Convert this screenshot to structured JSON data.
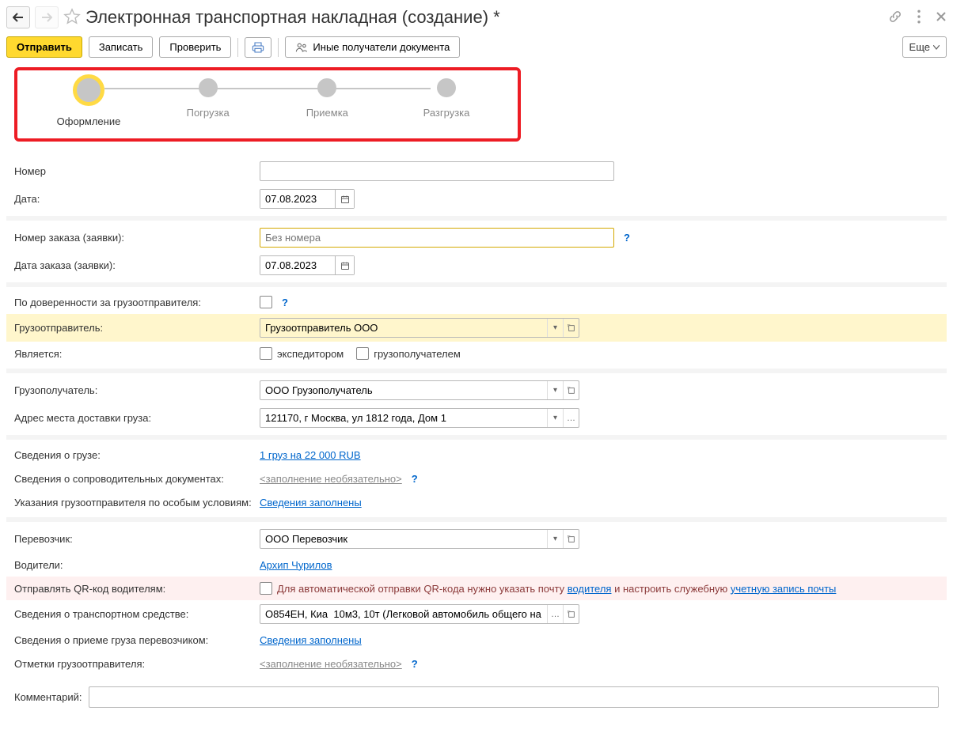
{
  "header": {
    "title": "Электронная транспортная накладная (создание) *"
  },
  "toolbar": {
    "send": "Отправить",
    "write": "Записать",
    "check": "Проверить",
    "other_recipients": "Иные получатели документа",
    "more": "Еще"
  },
  "stepper": {
    "steps": [
      "Оформление",
      "Погрузка",
      "Приемка",
      "Разгрузка"
    ]
  },
  "fields": {
    "number_label": "Номер",
    "number_value": "",
    "date_label": "Дата:",
    "date_value": "07.08.2023",
    "order_number_label": "Номер заказа (заявки):",
    "order_number_placeholder": "Без номера",
    "order_date_label": "Дата заказа (заявки):",
    "order_date_value": "07.08.2023",
    "proxy_label": "По доверенности за грузоотправителя:",
    "shipper_label": "Грузоотправитель:",
    "shipper_value": "Грузоотправитель ООО",
    "is_label": "Является:",
    "is_expeditor": "экспедитором",
    "is_consignee": "грузополучателем",
    "consignee_label": "Грузополучатель:",
    "consignee_value": "ООО Грузополучатель",
    "delivery_addr_label": "Адрес места доставки груза:",
    "delivery_addr_value": "121170, г Москва, ул 1812 года, Дом 1",
    "cargo_info_label": "Сведения о грузе:",
    "cargo_info_link": "1 груз на 22 000 RUB",
    "docs_label": "Сведения о сопроводительных документах:",
    "optional_fill": "<заполнение необязательно>",
    "shipper_notes_label": "Указания грузоотправителя по особым условиям:",
    "info_filled": "Сведения заполнены",
    "carrier_label": "Перевозчик:",
    "carrier_value": "ООО Перевозчик",
    "drivers_label": "Водители:",
    "drivers_link": "Архип Чурилов",
    "qr_label": "Отправлять QR-код водителям:",
    "qr_text_prefix": "Для автоматической отправки QR-кода нужно указать почту ",
    "qr_driver_link": "водителя",
    "qr_text_mid": " и настроить служебную ",
    "qr_account_link": "учетную запись почты",
    "vehicle_label": "Сведения о транспортном средстве:",
    "vehicle_value": "О854ЕН, Киа  10м3, 10т (Легковой автомобиль общего на",
    "acceptance_label": "Сведения о приеме груза перевозчиком:",
    "shipper_marks_label": "Отметки грузоотправителя:",
    "comment_label": "Комментарий:"
  },
  "help": "?"
}
